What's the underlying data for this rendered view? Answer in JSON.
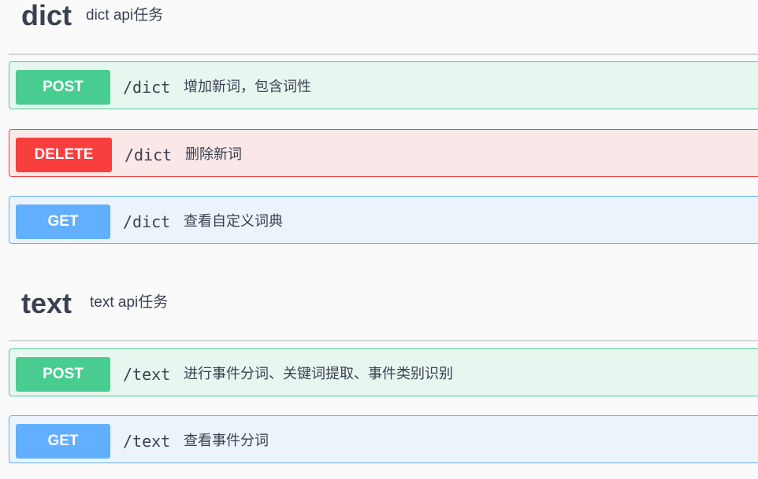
{
  "tags": [
    {
      "name": "dict",
      "description": "dict api任务",
      "operations": [
        {
          "method": "POST",
          "path": "/dict",
          "summary": "增加新词，包含词性"
        },
        {
          "method": "DELETE",
          "path": "/dict",
          "summary": "删除新词"
        },
        {
          "method": "GET",
          "path": "/dict",
          "summary": "查看自定义词典"
        }
      ]
    },
    {
      "name": "text",
      "description": "text api任务",
      "operations": [
        {
          "method": "POST",
          "path": "/text",
          "summary": "进行事件分词、关键词提取、事件类别识别"
        },
        {
          "method": "GET",
          "path": "/text",
          "summary": "查看事件分词"
        }
      ]
    }
  ],
  "colors": {
    "post": "#49cc90",
    "delete": "#f93e3e",
    "get": "#61affe",
    "text": "#3b4151"
  }
}
